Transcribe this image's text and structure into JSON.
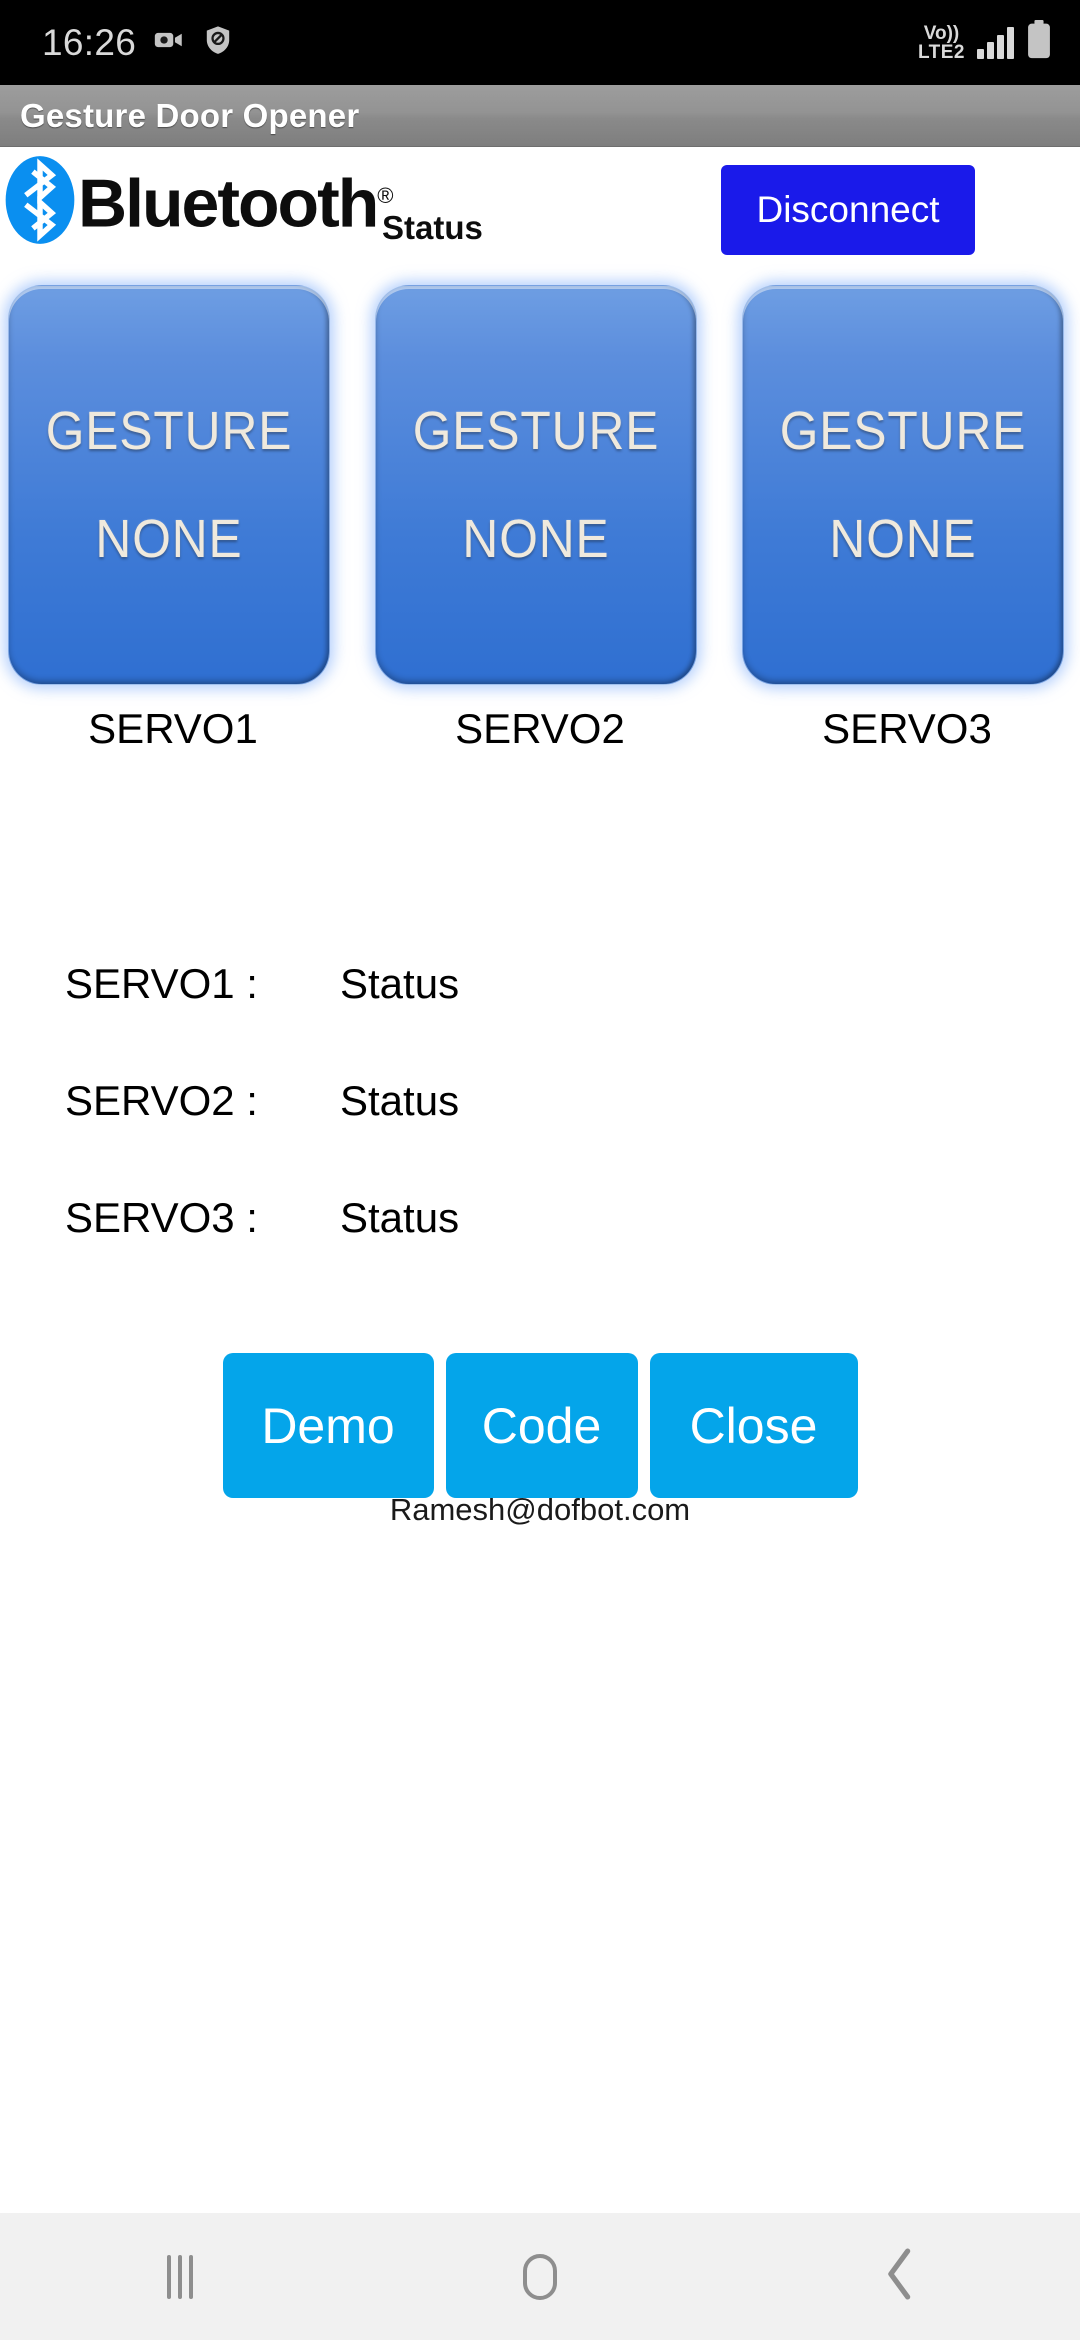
{
  "status_bar": {
    "clock": "16:26",
    "left_icons": [
      "screen-recorder-icon",
      "shield-blocked-icon"
    ],
    "volte_line1": "Vo))",
    "volte_line2": "LTE2",
    "signal_icon": "signal-bars-icon",
    "battery_icon": "battery-icon"
  },
  "title_bar": {
    "title": "Gesture Door Opener"
  },
  "header": {
    "bluetooth_wordmark": "Bluetooth",
    "bluetooth_registered": "®",
    "bluetooth_icon": "bluetooth-icon",
    "status_label": "Status",
    "disconnect_label": "Disconnect",
    "disconnect_color": "#1a1aea"
  },
  "gestures": [
    {
      "line1": "GESTURE",
      "line2": "NONE",
      "caption": "SERVO1"
    },
    {
      "line1": "GESTURE",
      "line2": "NONE",
      "caption": "SERVO2"
    },
    {
      "line1": "GESTURE",
      "line2": "NONE",
      "caption": "SERVO3"
    }
  ],
  "status_list": [
    {
      "label": "SERVO1 :",
      "value": "Status"
    },
    {
      "label": "SERVO2 :",
      "value": "Status"
    },
    {
      "label": "SERVO3 :",
      "value": "Status"
    }
  ],
  "actions": {
    "demo": "Demo",
    "code": "Code",
    "close": "Close",
    "color": "#04A5EA"
  },
  "footer": {
    "email": "Ramesh@dofbot.com"
  },
  "nav_bar": {
    "recents": "recents-icon",
    "home": "home-icon",
    "back": "back-icon"
  }
}
